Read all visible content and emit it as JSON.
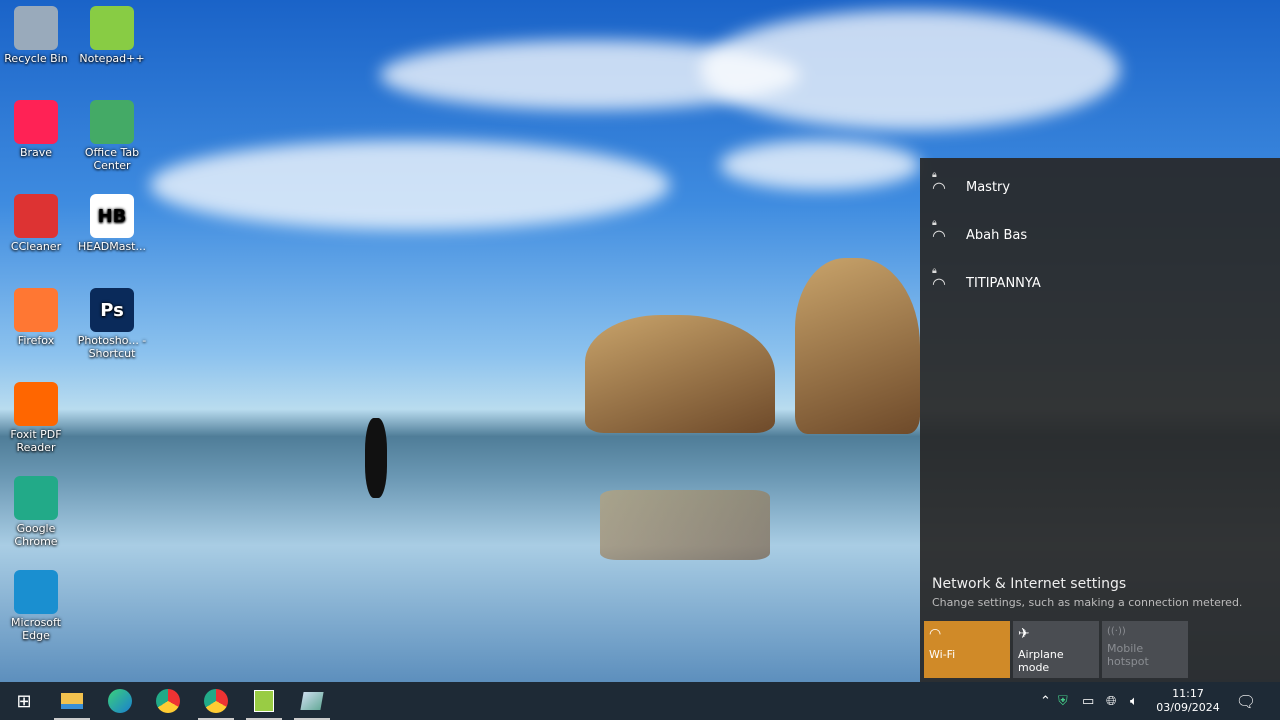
{
  "desktop_icons": [
    {
      "label": "Recycle Bin",
      "icon": "recycle-bin-icon",
      "color": "#9ab"
    },
    {
      "label": "Notepad++",
      "icon": "notepad-plus-plus-icon",
      "color": "#8c4"
    },
    {
      "label": "Brave",
      "icon": "brave-icon",
      "color": "#f25"
    },
    {
      "label": "Office Tab Center",
      "icon": "office-tab-icon",
      "color": "#4a6"
    },
    {
      "label": "CCleaner",
      "icon": "ccleaner-icon",
      "color": "#d33"
    },
    {
      "label": "HEADMast...",
      "icon": "headmaster-icon",
      "color": "#fff",
      "glyph": "HB"
    },
    {
      "label": "Firefox",
      "icon": "firefox-icon",
      "color": "#f73"
    },
    {
      "label": "Photosho... - Shortcut",
      "icon": "photoshop-icon",
      "color": "#0a2a5a",
      "glyph": "Ps"
    },
    {
      "label": "Foxit PDF Reader",
      "icon": "foxit-reader-icon",
      "color": "#f60"
    },
    {
      "label": "Google Chrome",
      "icon": "chrome-icon",
      "color": "#2a8"
    },
    {
      "label": "Microsoft Edge",
      "icon": "edge-icon",
      "color": "#1a8fd0"
    }
  ],
  "network_flyout": {
    "networks": [
      {
        "name": "Mastry",
        "secured": true
      },
      {
        "name": "Abah Bas",
        "secured": true
      },
      {
        "name": "TITIPANNYA",
        "secured": true
      }
    ],
    "settings_title": "Network & Internet settings",
    "settings_subtitle": "Change settings, such as making a connection metered.",
    "tiles": [
      {
        "label": "Wi-Fi",
        "icon": "wifi-icon",
        "active": true,
        "color": "#d08a28"
      },
      {
        "label": "Airplane mode",
        "icon": "airplane-icon",
        "active": false
      },
      {
        "label": "Mobile hotspot",
        "icon": "hotspot-icon",
        "active": false,
        "disabled": true
      }
    ]
  },
  "taskbar": {
    "apps": [
      "start",
      "file-explorer",
      "edge",
      "chrome",
      "chrome-profile",
      "notepad-plus-plus",
      "app"
    ],
    "time": "11:17",
    "date": "03/09/2024"
  }
}
